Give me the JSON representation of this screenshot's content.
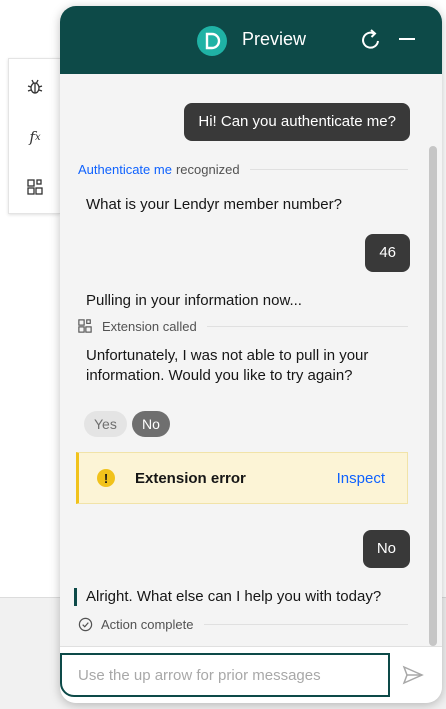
{
  "header": {
    "title": "Preview"
  },
  "messages": {
    "user_greeting": "Hi! Can you authenticate me?",
    "recognized_action": "Authenticate me",
    "recognized_suffix": "recognized",
    "bot_member_question": "What is your Lendyr member number?",
    "user_member_number": "46",
    "bot_pulling": "Pulling in your information now...",
    "extension_called": "Extension called",
    "bot_failure_line1": "Unfortunately, I was not able to pull in your",
    "bot_failure_line2": "information. Would you like to try again?",
    "option_yes": "Yes",
    "option_no": "No",
    "error_title": "Extension error",
    "error_link": "Inspect",
    "user_reply": "No",
    "bot_closing": "Alright. What else can I help you with today?",
    "action_complete": "Action complete"
  },
  "input": {
    "placeholder": "Use the up arrow for prior messages"
  },
  "toolbar": {
    "debug_icon": "bug-icon",
    "function_icon": "function-icon",
    "extension_icon": "extension-icon"
  },
  "colors": {
    "header_bg": "#0d4a48",
    "logo": "#1fb2a5",
    "link": "#0f62fe",
    "warning": "#f1c21b",
    "user_bubble": "#393939"
  }
}
